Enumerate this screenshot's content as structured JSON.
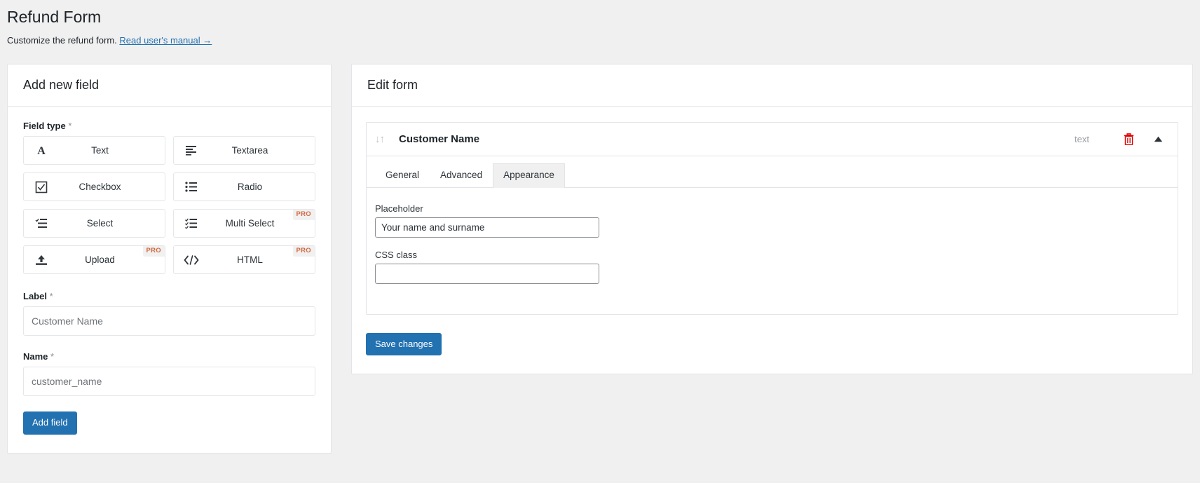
{
  "page": {
    "title": "Refund Form",
    "subtitle_text": "Customize the refund form.",
    "manual_link": "Read user's manual →"
  },
  "add_field_panel": {
    "header": "Add new field",
    "field_type_label": "Field type",
    "required_mark": "*",
    "field_types": [
      {
        "label": "Text",
        "icon": "text-icon",
        "pro": false,
        "pro_label": ""
      },
      {
        "label": "Textarea",
        "icon": "textarea-icon",
        "pro": false,
        "pro_label": ""
      },
      {
        "label": "Checkbox",
        "icon": "checkbox-icon",
        "pro": false,
        "pro_label": ""
      },
      {
        "label": "Radio",
        "icon": "radio-list-icon",
        "pro": false,
        "pro_label": ""
      },
      {
        "label": "Select",
        "icon": "select-icon",
        "pro": false,
        "pro_label": ""
      },
      {
        "label": "Multi Select",
        "icon": "multi-select-icon",
        "pro": true,
        "pro_label": "PRO"
      },
      {
        "label": "Upload",
        "icon": "upload-icon",
        "pro": true,
        "pro_label": "PRO"
      },
      {
        "label": "HTML",
        "icon": "code-icon",
        "pro": true,
        "pro_label": "PRO"
      }
    ],
    "label_field": {
      "label": "Label",
      "required_mark": "*",
      "placeholder": "Customer Name",
      "value": ""
    },
    "name_field": {
      "label": "Name",
      "required_mark": "*",
      "placeholder": "customer_name",
      "value": ""
    },
    "add_button": "Add field"
  },
  "edit_form_panel": {
    "header": "Edit form",
    "field": {
      "title": "Customer Name",
      "type_badge": "text",
      "sort_handle_glyph": "↓↑",
      "delete_icon": "trash-icon",
      "collapse_icon": "chevron-up-icon",
      "tabs": [
        {
          "label": "General",
          "active": false
        },
        {
          "label": "Advanced",
          "active": false
        },
        {
          "label": "Appearance",
          "active": true
        }
      ],
      "appearance": {
        "placeholder_label": "Placeholder",
        "placeholder_value": "Your name and surname",
        "placeholder_hint": "",
        "css_class_label": "CSS class",
        "css_class_value": "",
        "css_class_hint": ""
      }
    },
    "save_button": "Save changes"
  },
  "colors": {
    "accent": "#2271b1",
    "link": "#2271b1",
    "danger": "#e00000",
    "pro_badge_text": "#d4683f",
    "page_bg": "#f0f0f1"
  }
}
